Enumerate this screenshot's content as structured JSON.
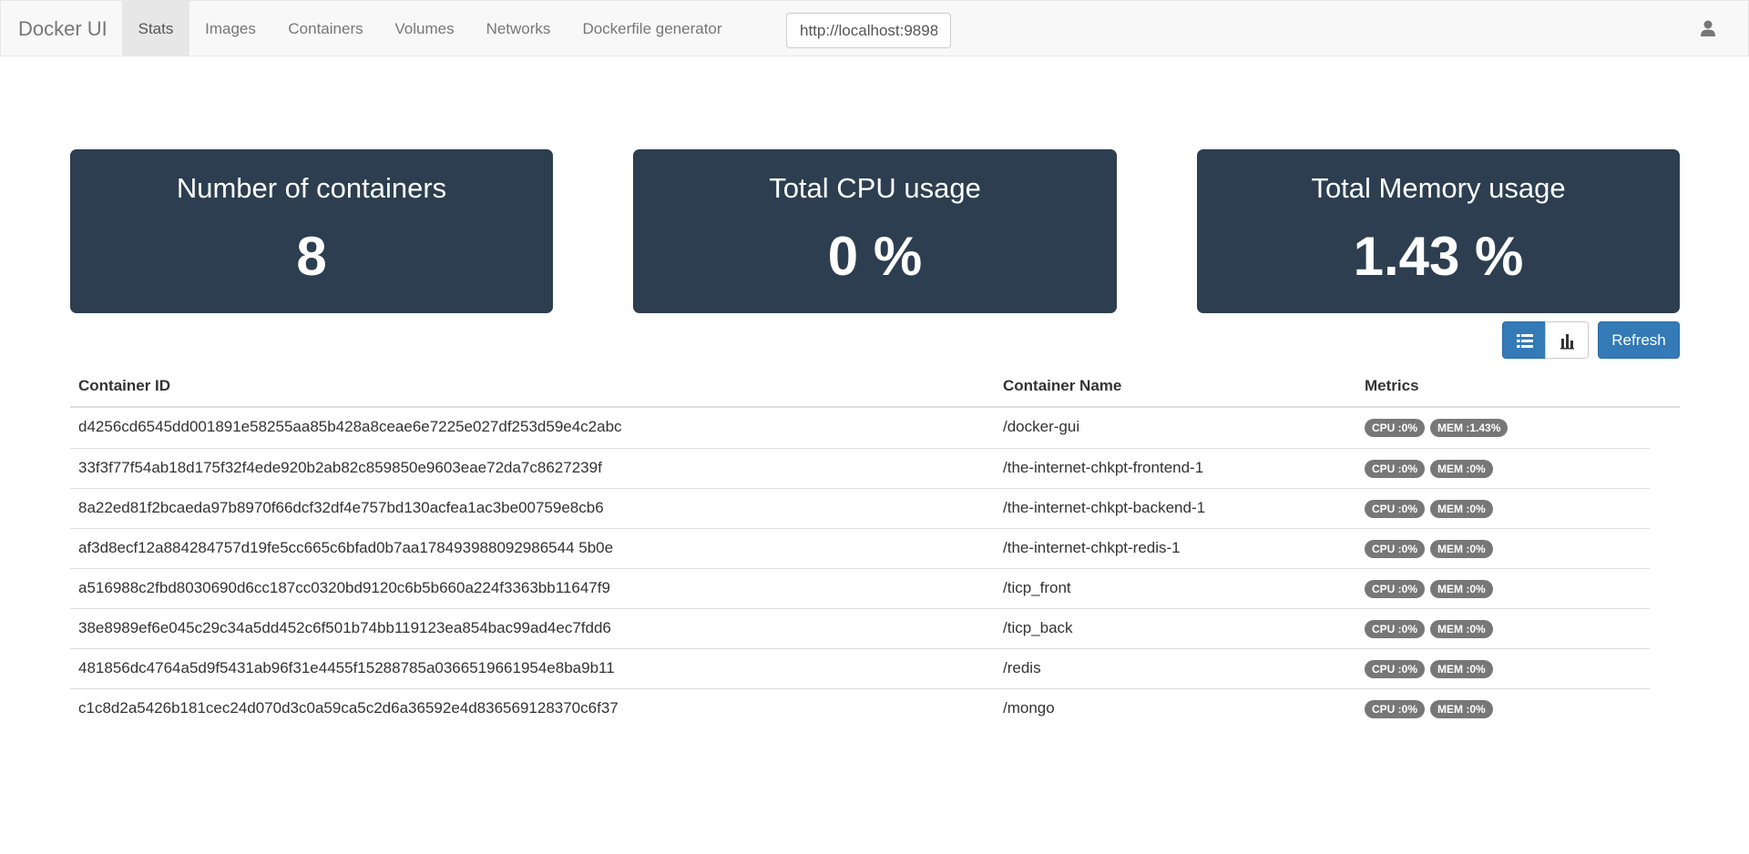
{
  "navbar": {
    "brand": "Docker UI",
    "items": [
      {
        "label": "Stats",
        "active": true
      },
      {
        "label": "Images"
      },
      {
        "label": "Containers"
      },
      {
        "label": "Volumes"
      },
      {
        "label": "Networks"
      },
      {
        "label": "Dockerfile generator"
      }
    ],
    "url_value": "http://localhost:9898",
    "user_icon": "user-icon"
  },
  "panels": [
    {
      "title": "Number of containers",
      "value": "8"
    },
    {
      "title": "Total CPU usage",
      "value": "0 %"
    },
    {
      "title": "Total Memory usage",
      "value": "1.43 %"
    }
  ],
  "toolbar": {
    "list_icon": "list-icon",
    "chart_icon": "bar-chart-icon",
    "refresh_label": "Refresh"
  },
  "table": {
    "headers": [
      "Container ID",
      "Container Name",
      "Metrics"
    ],
    "rows": [
      {
        "id": "d4256cd6545dd001891e58255aa85b428a8ceae6e7225e027df253d59e4c2abc",
        "name": "/docker-gui",
        "cpu": "CPU :0%",
        "mem": "MEM :1.43%"
      },
      {
        "id": "33f3f77f54ab18d175f32f4ede920b2ab82c859850e9603eae72da7c8627239f",
        "name": "/the-internet-chkpt-frontend-1",
        "cpu": "CPU :0%",
        "mem": "MEM :0%"
      },
      {
        "id": "8a22ed81f2bcaeda97b8970f66dcf32df4e757bd130acfea1ac3be00759e8cb6",
        "name": "/the-internet-chkpt-backend-1",
        "cpu": "CPU :0%",
        "mem": "MEM :0%"
      },
      {
        "id": "af3d8ecf12a884284757d19fe5cc665c6bfad0b7aa178493988092986544 5b0e",
        "name": "/the-internet-chkpt-redis-1",
        "cpu": "CPU :0%",
        "mem": "MEM :0%"
      },
      {
        "id": "a516988c2fbd8030690d6cc187cc0320bd9120c6b5b660a224f3363bb11647f9",
        "name": "/ticp_front",
        "cpu": "CPU :0%",
        "mem": "MEM :0%"
      },
      {
        "id": "38e8989ef6e045c29c34a5dd452c6f501b74bb119123ea854bac99ad4ec7fdd6",
        "name": "/ticp_back",
        "cpu": "CPU :0%",
        "mem": "MEM :0%"
      },
      {
        "id": "481856dc4764a5d9f5431ab96f31e4455f15288785a0366519661954e8ba9b11",
        "name": "/redis",
        "cpu": "CPU :0%",
        "mem": "MEM :0%"
      },
      {
        "id": "c1c8d2a5426b181cec24d070d3c0a59ca5c2d6a36592e4d836569128370c6f37",
        "name": "/mongo",
        "cpu": "CPU :0%",
        "mem": "MEM :0%"
      }
    ]
  }
}
